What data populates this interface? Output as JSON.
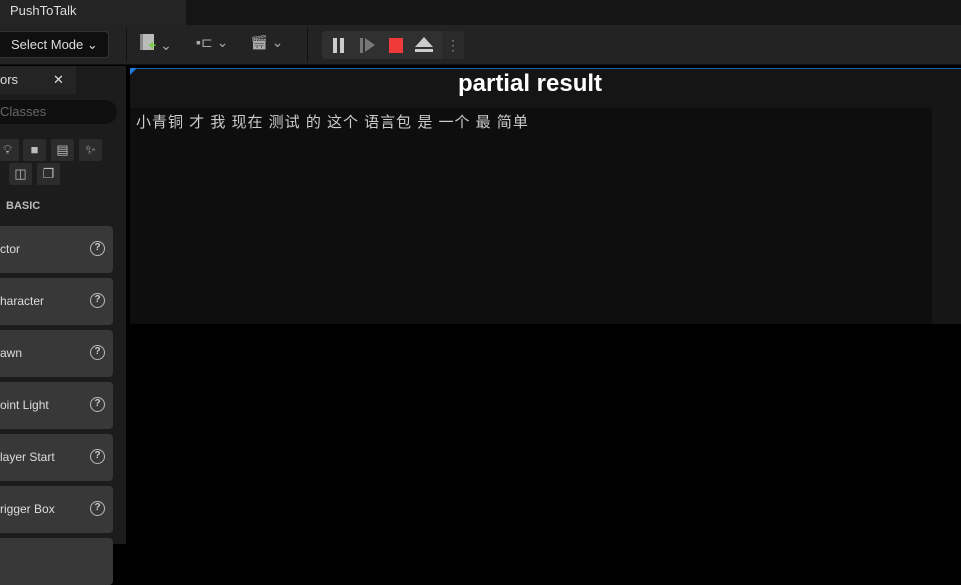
{
  "window": {
    "tab_title": "PushToTalk"
  },
  "toolbar": {
    "select_mode": "Select Mode",
    "colors": {
      "stop": "#f03a3a",
      "add_green": "#6fce3a"
    }
  },
  "place_actors": {
    "tab_label": "ors",
    "search_placeholder": "Classes",
    "section": "BASIC",
    "items": [
      {
        "label": "ctor"
      },
      {
        "label": "haracter"
      },
      {
        "label": "awn"
      },
      {
        "label": "oint Light"
      },
      {
        "label": "layer Start"
      },
      {
        "label": "rigger Box"
      }
    ]
  },
  "viewport": {
    "title": "partial result",
    "text": "小青铜 才 我 现在 测试 的 这个 语言包 是 一个 最 简单"
  }
}
